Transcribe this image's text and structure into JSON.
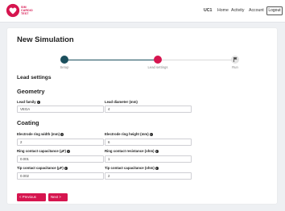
{
  "brand": {
    "line1": "SIM",
    "line2": "CARDIO",
    "line3": "TEST",
    "color": "#d6154f"
  },
  "nav": {
    "uc1": "UC1",
    "home": "Home",
    "activity": "Activity",
    "account": "Account",
    "logout": "Logout"
  },
  "page": {
    "title": "New Simulation"
  },
  "stepper": {
    "steps": [
      {
        "label": "Setup",
        "state": "completed"
      },
      {
        "label": "Lead settings",
        "state": "active"
      },
      {
        "label": "Run",
        "state": "pending"
      }
    ],
    "colors": {
      "completed": "#1b4f5d",
      "active": "#d6154f",
      "pending": "#e3e3e3"
    }
  },
  "lead_settings": {
    "heading": "Lead settings",
    "geometry": {
      "heading": "Geometry",
      "lead_family": {
        "label": "Lead family",
        "value": "VEGA"
      },
      "lead_diameter": {
        "label": "Lead diameter (mm)",
        "value": "4"
      }
    },
    "coating": {
      "heading": "Coating",
      "ring_width": {
        "label": "Electrode ring width (mm)",
        "value": "2"
      },
      "ring_height": {
        "label": "Electrode ring height (mm)",
        "value": "6"
      },
      "ring_capacitance": {
        "label": "Ring contact capacitance (µF)",
        "value": "0.001"
      },
      "ring_resistance": {
        "label": "Ring contact resistance (ohm)",
        "value": "1"
      },
      "tip_capacitance": {
        "label": "Tip contact capacitance (µF)",
        "value": "0.002"
      },
      "tip_resistance": {
        "label": "Tip contact capacitance (ohm)",
        "value": "2"
      }
    }
  },
  "actions": {
    "previous": "< Previous",
    "next": "Next >"
  },
  "icons": {
    "info": "info-icon",
    "run": "flag-icon",
    "logo": "heart-logo-icon"
  }
}
